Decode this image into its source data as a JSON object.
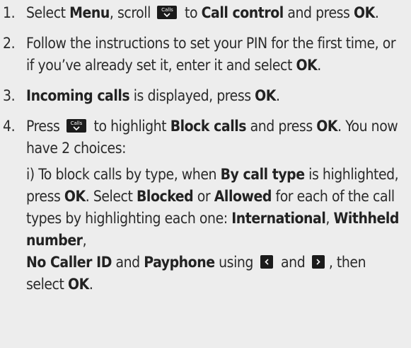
{
  "steps": [
    {
      "number": "1.",
      "t1": "Select ",
      "b1": "Menu",
      "t2": ", scroll ",
      "key": "Calls",
      "t3": " to ",
      "b2": "Call control",
      "t4": " and press ",
      "b3": "OK",
      "t5": "."
    },
    {
      "number": "2.",
      "t1": "Follow the instructions to set your PIN for the first time, or if you’ve already set it, enter it and select ",
      "b1": "OK",
      "t2": "."
    },
    {
      "number": "3.",
      "b1": "Incoming calls",
      "t1": " is displayed, press ",
      "b2": "OK",
      "t2": "."
    },
    {
      "number": "4.",
      "t1": "Press ",
      "key": "Calls",
      "t2": " to highlight ",
      "b1": "Block calls",
      "t3": " and press ",
      "b2": "OK",
      "t4": ". You now have 2 choices:",
      "sub": {
        "t1": "i) To block calls by type, when ",
        "b1": "By call type",
        "t2": " is highlighted, press ",
        "b2": "OK",
        "t3": ". Select ",
        "b3": "Blocked",
        "t4": " or ",
        "b4": "Allowed",
        "t5": " for each of the call types by highlighting each one: ",
        "b5": "International",
        "t6": ", ",
        "b6": "Withheld number",
        "t7": ",",
        "b7": "No Caller ID",
        "t8": " and ",
        "b8": "Payphone",
        "t9": " using ",
        "t10": " and ",
        "t11": ", then select ",
        "b9": "OK",
        "t12": "."
      }
    }
  ],
  "icons": {
    "calls_key": "calls-scroll-key-icon",
    "left_key": "left-arrow-key-icon",
    "right_key": "right-arrow-key-icon"
  }
}
